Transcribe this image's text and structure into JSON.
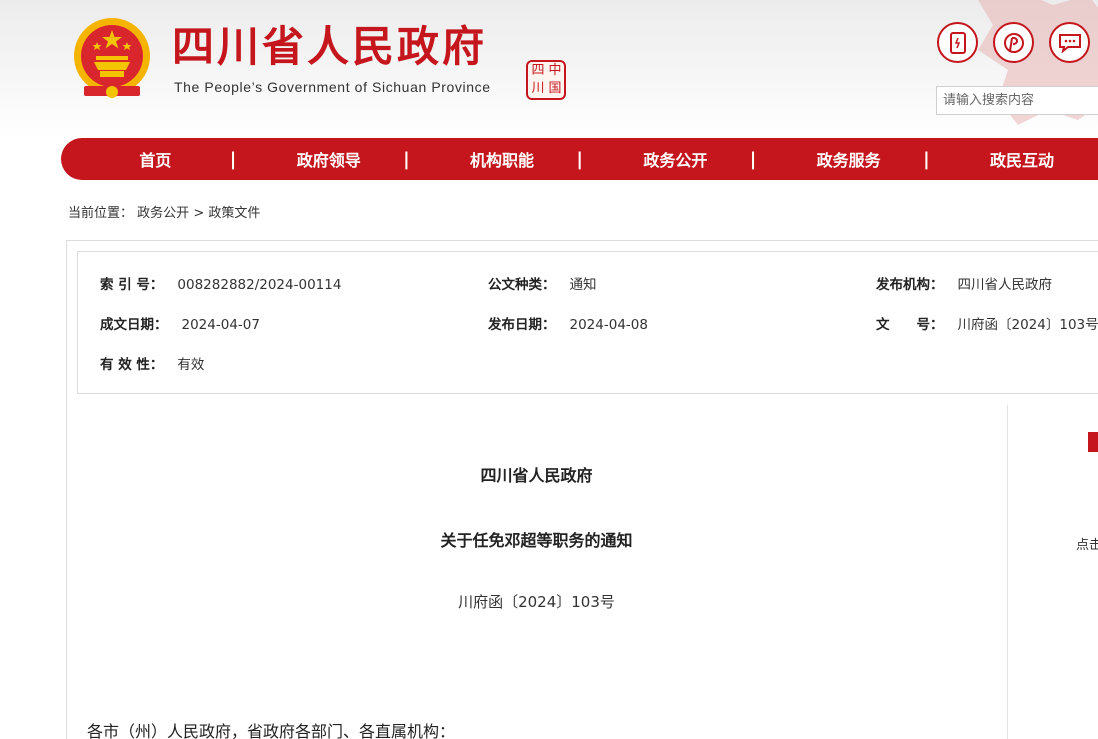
{
  "header": {
    "title": "四川省人民政府",
    "subtitle": "The People’s Government of Sichuan Province",
    "seal_chars": [
      "中",
      "国",
      "四",
      "川"
    ],
    "icons": [
      "mobile-icon",
      "pinterest-icon",
      "message-icon"
    ],
    "search": {
      "placeholder": "请输入搜索内容"
    }
  },
  "nav": {
    "items": [
      {
        "label": "首页"
      },
      {
        "label": "政府领导"
      },
      {
        "label": "机构职能"
      },
      {
        "label": "政务公开"
      },
      {
        "label": "政务服务"
      },
      {
        "label": "政民互动"
      }
    ],
    "separator": "|"
  },
  "breadcrumb": {
    "prefix": "当前位置：",
    "items": [
      "政务公开",
      "政策文件"
    ],
    "separator": ">"
  },
  "meta": {
    "index_label": "索 引 号：",
    "index_value": "008282882/2024-00114",
    "doc_type_label": "公文种类：",
    "doc_type_value": "通知",
    "publisher_label": "发布机构：",
    "publisher_value": "四川省人民政府",
    "created_label": "成文日期：",
    "created_value": "2024-04-07",
    "published_label": "发布日期：",
    "published_value": "2024-04-08",
    "doc_no_label": "文　　号：",
    "doc_no_value": "川府函〔2024〕103号",
    "validity_label": "有 效 性：",
    "validity_value": "有效"
  },
  "document": {
    "issuer": "四川省人民政府",
    "title": "关于任免邓超等职务的通知",
    "number": "川府函〔2024〕103号",
    "greeting": "各市（州）人民政府，省政府各部门、各直属机构："
  },
  "sidebar": {
    "partial_text": "点击"
  },
  "colors": {
    "brand_red": "#c4161c",
    "gold": "#f5b400"
  }
}
